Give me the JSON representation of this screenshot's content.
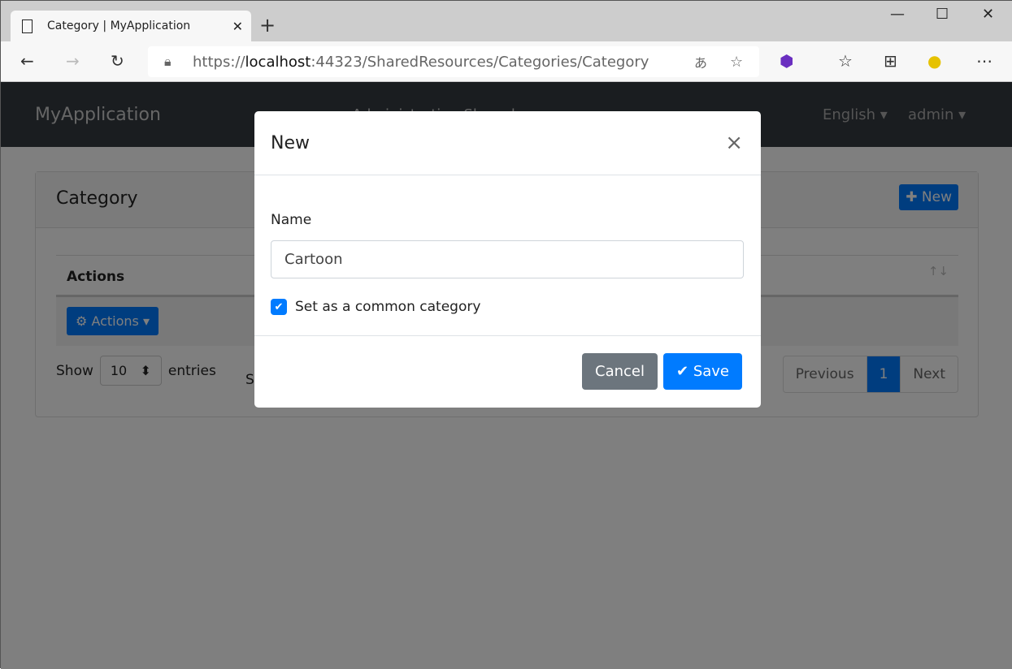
{
  "browser": {
    "tab_title": "Category | MyApplication",
    "url_prefix": "https://",
    "url_host": "localhost",
    "url_rest": ":44323/SharedResources/Categories/Category"
  },
  "navbar": {
    "brand": "MyApplication",
    "menu": "Administration    Shared",
    "language": "English",
    "user": "admin"
  },
  "card": {
    "title": "Category",
    "new_label": "New",
    "column_header": "Actions",
    "actions_label": "Actions",
    "show_label": "Show",
    "entries_value": "10",
    "entries_label": "entries",
    "info_partial": "S",
    "pagination": {
      "previous": "Previous",
      "current": "1",
      "next": "Next"
    }
  },
  "modal": {
    "title": "New",
    "name_label": "Name",
    "name_value": "Cartoon",
    "checkbox_label": "Set as a common category",
    "checkbox_checked": true,
    "cancel_label": "Cancel",
    "save_label": "Save"
  },
  "colors": {
    "primary": "#007bff",
    "secondary": "#6c757d",
    "navbar": "#343a40"
  }
}
